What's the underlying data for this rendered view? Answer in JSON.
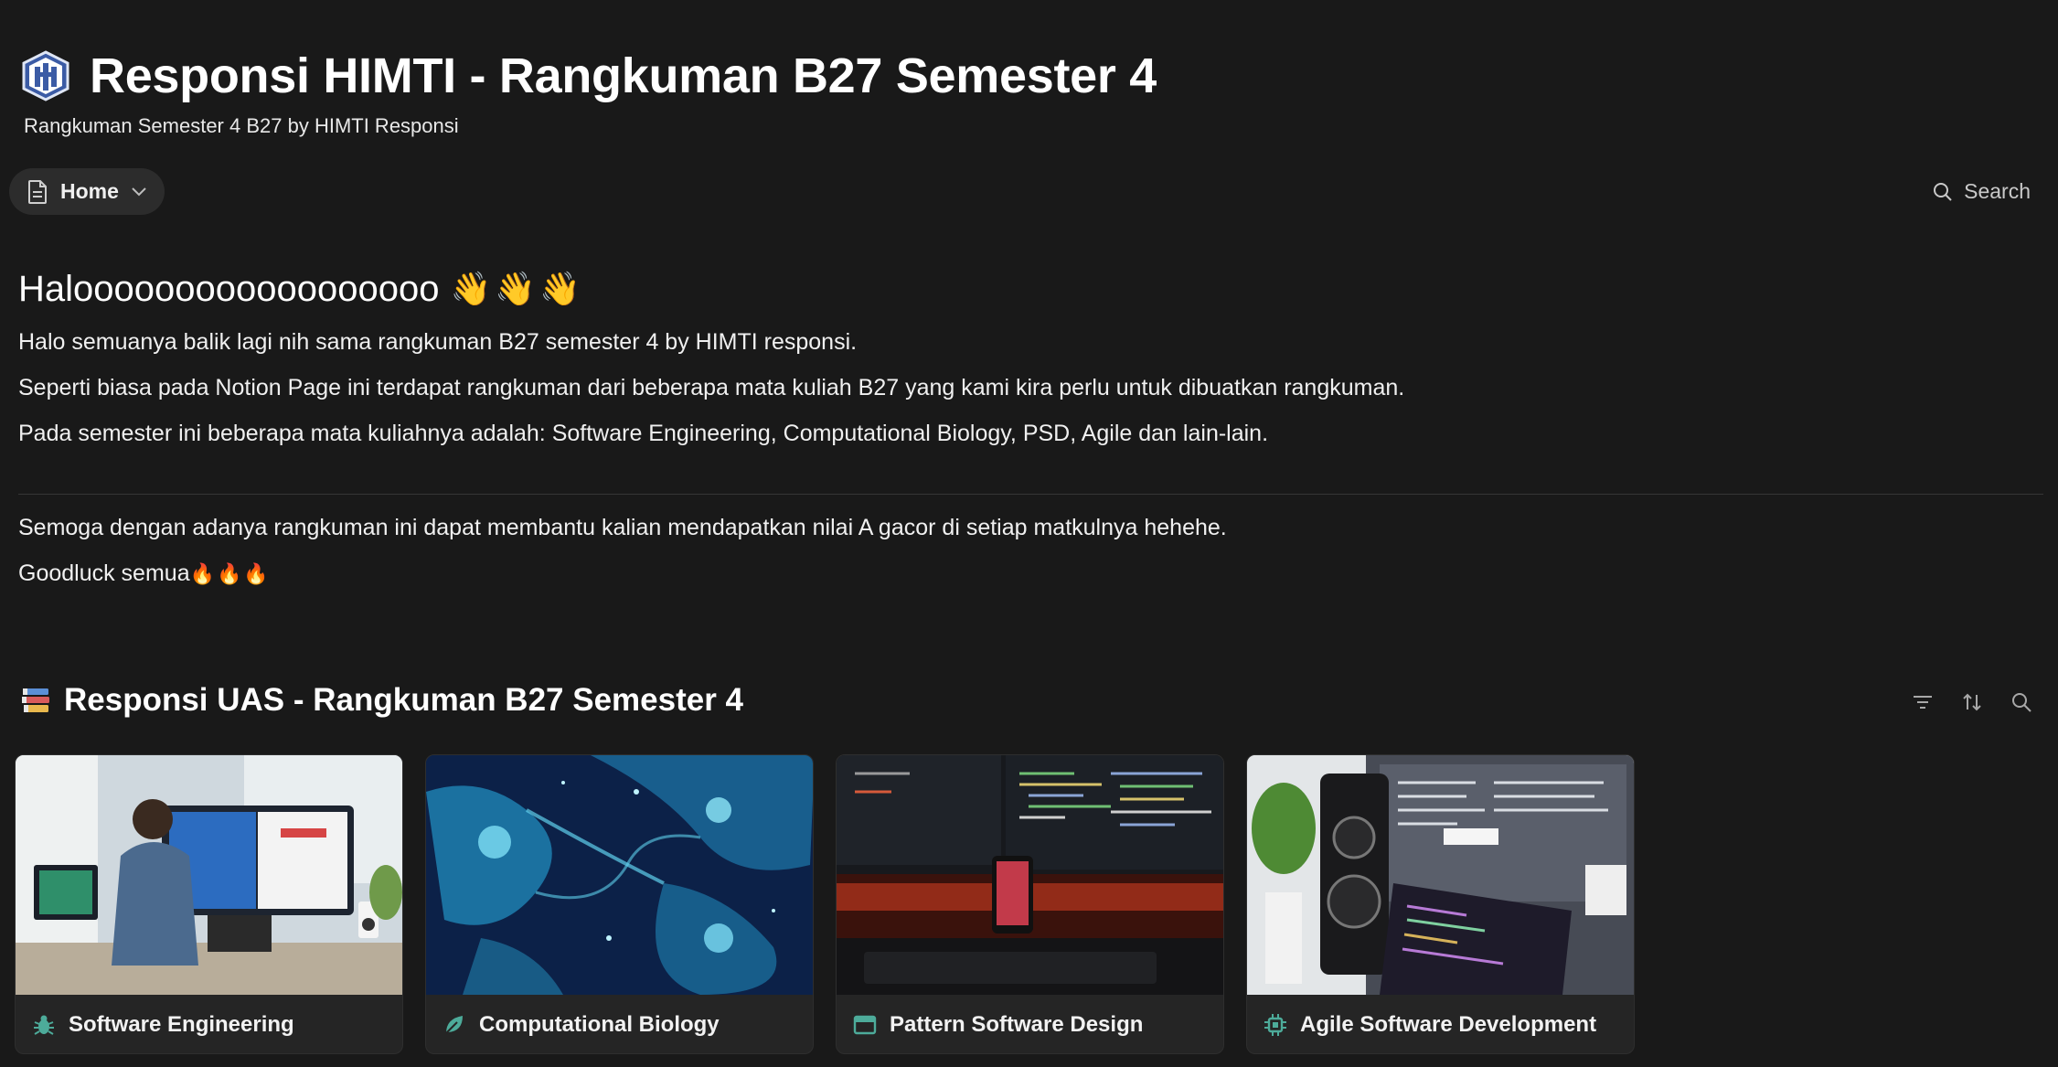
{
  "header": {
    "title": "Responsi HIMTI - Rangkuman B27 Semester 4",
    "subtitle": "Rangkuman Semester 4 B27 by HIMTI Responsi"
  },
  "nav": {
    "home_label": "Home",
    "search_label": "Search"
  },
  "content": {
    "heading": "Haloooooooooooooooooo",
    "heading_emoji": "👋👋👋",
    "paragraphs": [
      "Halo semuanya balik lagi nih sama rangkuman B27 semester 4 by HIMTI responsi.",
      "Seperti biasa pada Notion Page ini terdapat rangkuman dari beberapa mata kuliah B27 yang kami kira perlu untuk dibuatkan rangkuman.",
      "Pada semester ini beberapa mata kuliahnya adalah: Software Engineering, Computational Biology, PSD, Agile dan lain-lain."
    ],
    "closing": [
      "Semoga dengan adanya rangkuman ini dapat membantu kalian mendapatkan nilai A gacor di setiap matkulnya hehehe.",
      "Goodluck semua"
    ],
    "closing_emoji": "🔥🔥🔥"
  },
  "database": {
    "icon": "books-icon",
    "title": "Responsi UAS - Rangkuman B27 Semester 4",
    "cards": [
      {
        "title": "Software Engineering",
        "icon": "bug-icon",
        "icon_color": "#4dab9a"
      },
      {
        "title": "Computational Biology",
        "icon": "leaf-icon",
        "icon_color": "#4dab9a"
      },
      {
        "title": "Pattern Software Design",
        "icon": "browser-icon",
        "icon_color": "#4dab9a"
      },
      {
        "title": "Agile Software Development",
        "icon": "chip-icon",
        "icon_color": "#4dab9a"
      }
    ]
  },
  "colors": {
    "background": "#191919",
    "card": "#252525",
    "accent_green": "#4dab9a"
  }
}
